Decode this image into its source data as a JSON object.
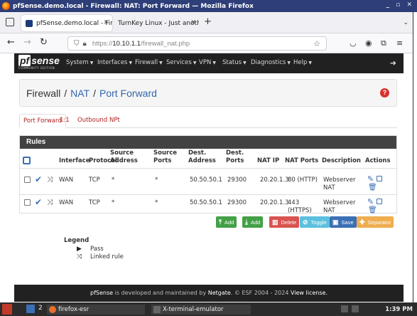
{
  "window": {
    "title": "pfSense.demo.local - Firewall: NAT: Port Forward — Mozilla Firefox",
    "controls": "_ ▫ ✕"
  },
  "tabs": [
    {
      "label": "pfSense.demo.local - Fire",
      "active": true
    },
    {
      "label": "TurnKey Linux - Just another",
      "active": false
    }
  ],
  "browser": {
    "url_prefix": "https://",
    "url_host": "10.10.1.1",
    "url_path": "/firewall_nat.php"
  },
  "pfsense": {
    "logo": "sense",
    "logo_pf": "pf",
    "edition": "COMMUNITY EDITION",
    "menu": [
      {
        "label": "System"
      },
      {
        "label": "Interfaces"
      },
      {
        "label": "Firewall"
      },
      {
        "label": "Services"
      },
      {
        "label": "VPN"
      },
      {
        "label": "Status"
      },
      {
        "label": "Diagnostics"
      },
      {
        "label": "Help"
      }
    ]
  },
  "breadcrumb": {
    "root": "Firewall",
    "sep": "/",
    "level2": "NAT",
    "level3": "Port Forward"
  },
  "subtabs": [
    {
      "label": "Port Forward",
      "active": true
    },
    {
      "label": "1:1",
      "active": false
    },
    {
      "label": "Outbound",
      "active": false
    },
    {
      "label": "NPt",
      "active": false
    }
  ],
  "rules_panel": {
    "title": "Rules",
    "headers": {
      "interface": "Interface",
      "protocol": "Protocol",
      "src_address_1": "Source",
      "src_address_2": "Address",
      "src_ports_1": "Source",
      "src_ports_2": "Ports",
      "dest_address_1": "Dest.",
      "dest_address_2": "Address",
      "dest_ports_1": "Dest.",
      "dest_ports_2": "Ports",
      "nat_ip": "NAT IP",
      "nat_ports": "NAT Ports",
      "description": "Description",
      "actions": "Actions"
    },
    "rows": [
      {
        "interface": "WAN",
        "protocol": "TCP",
        "src_address": "*",
        "src_ports": "*",
        "dest_address": "50.50.50.1",
        "dest_ports": "29300",
        "nat_ip": "20.20.1.3",
        "nat_ports_1": "80 (HTTP)",
        "nat_ports_2": "",
        "description_1": "Webserver",
        "description_2": "NAT"
      },
      {
        "interface": "WAN",
        "protocol": "TCP",
        "src_address": "*",
        "src_ports": "*",
        "dest_address": "50.50.50.1",
        "dest_ports": "29300",
        "nat_ip": "20.20.1.3",
        "nat_ports_1": "443",
        "nat_ports_2": "(HTTPS)",
        "description_1": "Webserver",
        "description_2": "NAT"
      }
    ]
  },
  "buttons": [
    {
      "label": "Add",
      "icon": "arrow-up-icon",
      "color": "#43a047"
    },
    {
      "label": "Add",
      "icon": "arrow-down-icon",
      "color": "#43a047"
    },
    {
      "label": "Delete",
      "icon": "trash-icon",
      "color": "#d9534f"
    },
    {
      "label": "Toggle",
      "icon": "ban-icon",
      "color": "#5bc0de"
    },
    {
      "label": "Save",
      "icon": "save-icon",
      "color": "#3a6fb5"
    },
    {
      "label": "Separator",
      "icon": "plus-icon",
      "color": "#f0ad4e"
    }
  ],
  "legend": {
    "title": "Legend",
    "items": [
      {
        "icon": "play-icon",
        "label": "Pass"
      },
      {
        "icon": "shuffle-icon",
        "label": "Linked rule"
      }
    ]
  },
  "footer": {
    "brand": "pfSense",
    "text1": " is developed and maintained by ",
    "company": "Netgate",
    "text2": ". © ESF 2004 - 2024 ",
    "license": "View license."
  },
  "taskbar": {
    "workspace": "2",
    "tasks": [
      {
        "label": "firefox-esr"
      },
      {
        "label": "X-terminal-emulator"
      }
    ],
    "clock": "1:39 PM"
  }
}
